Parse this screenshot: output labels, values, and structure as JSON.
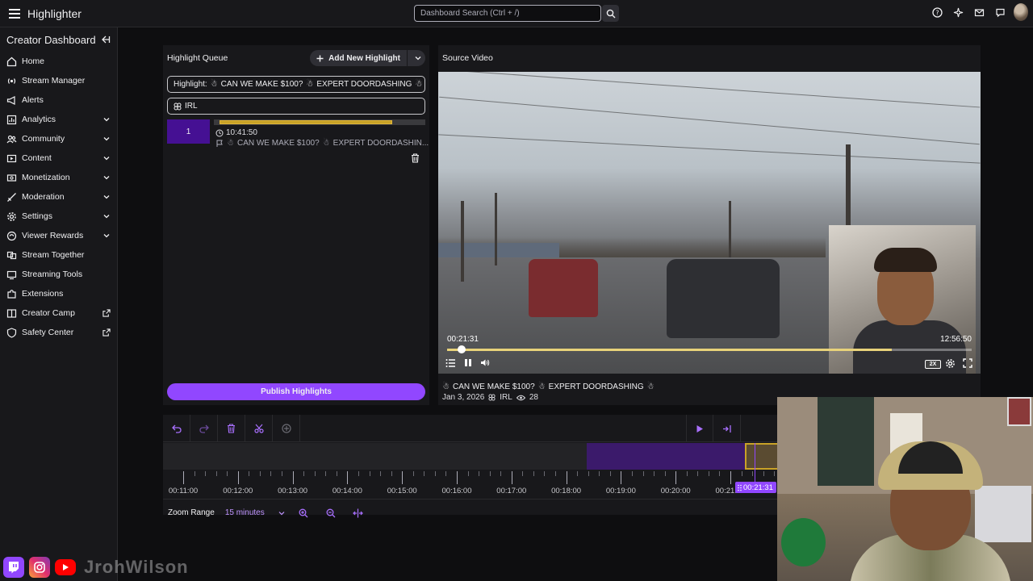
{
  "topbar": {
    "app_title": "Highlighter",
    "search_placeholder": "Dashboard Search (Ctrl + /)"
  },
  "sidebar": {
    "title": "Creator Dashboard",
    "items": [
      {
        "label": "Home",
        "icon": "home-icon",
        "expandable": false
      },
      {
        "label": "Stream Manager",
        "icon": "stream-manager-icon",
        "expandable": false
      },
      {
        "label": "Alerts",
        "icon": "megaphone-icon",
        "expandable": false
      },
      {
        "label": "Analytics",
        "icon": "chart-icon",
        "expandable": true
      },
      {
        "label": "Community",
        "icon": "community-icon",
        "expandable": true
      },
      {
        "label": "Content",
        "icon": "content-icon",
        "expandable": true
      },
      {
        "label": "Monetization",
        "icon": "money-icon",
        "expandable": true
      },
      {
        "label": "Moderation",
        "icon": "sword-icon",
        "expandable": true
      },
      {
        "label": "Settings",
        "icon": "gear-icon",
        "expandable": true
      },
      {
        "label": "Viewer Rewards",
        "icon": "rewards-icon",
        "expandable": true
      },
      {
        "label": "Stream Together",
        "icon": "stream-together-icon",
        "expandable": false
      },
      {
        "label": "Streaming Tools",
        "icon": "tools-icon",
        "expandable": false
      },
      {
        "label": "Extensions",
        "icon": "extensions-icon",
        "expandable": false
      },
      {
        "label": "Creator Camp",
        "icon": "creator-camp-icon",
        "external": true
      },
      {
        "label": "Safety Center",
        "icon": "shield-icon",
        "external": true
      }
    ]
  },
  "queue": {
    "title": "Highlight Queue",
    "add_button": "Add New Highlight",
    "highlight_title_label": "Highlight:",
    "highlight_title_value": "CAN WE MAKE $100?",
    "highlight_title_value2": "EXPERT DOORDASHING",
    "category": "IRL",
    "items": [
      {
        "number": "1",
        "time": "10:41:50",
        "title_a": "CAN WE MAKE $100?",
        "title_b": "EXPERT DOORDASHIN..."
      }
    ],
    "publish_button": "Publish Highlights"
  },
  "video": {
    "panel_title": "Source Video",
    "time_current": "00:21:31",
    "time_total": "12:56:50",
    "speed_badge": "2X",
    "title_a": "CAN WE MAKE $100?",
    "title_b": "EXPERT DOORDASHING",
    "date": "Jan 3, 2026",
    "category": "IRL",
    "views": "28",
    "progress_fraction": 0.028
  },
  "timeline": {
    "labels": [
      "00:11:00",
      "00:12:00",
      "00:13:00",
      "00:14:00",
      "00:15:00",
      "00:16:00",
      "00:17:00",
      "00:18:00",
      "00:19:00",
      "00:20:00",
      "00:21:00"
    ],
    "playhead_label": "00:21:31",
    "zoom_label": "Zoom Range",
    "zoom_value": "15 minutes"
  },
  "overlay": {
    "handle": "JrohWilson"
  },
  "colors": {
    "accent": "#9147ff",
    "highlight_gold": "#c9a227",
    "queue_number_bg": "#451093"
  }
}
